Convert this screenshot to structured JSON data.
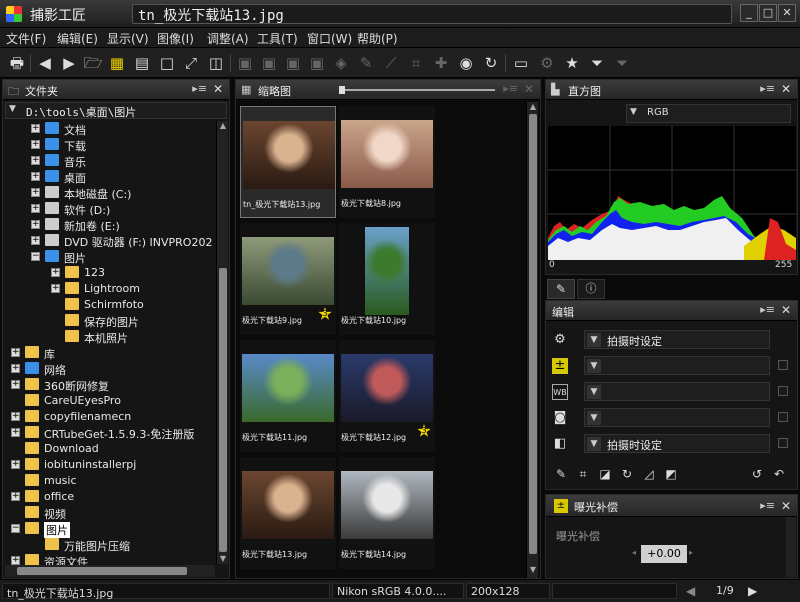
{
  "window": {
    "app_title": "捕影工匠",
    "file_title": "tn_极光下载站13.jpg",
    "minimize": "_",
    "maximize": "□",
    "close": "✕"
  },
  "menu": [
    "文件(F)",
    "编辑(E)",
    "显示(V)",
    "图像(I)",
    "调整(A)",
    "工具(T)",
    "窗口(W)",
    "帮助(P)"
  ],
  "toolbar": {
    "icons": [
      "print-icon",
      "back-icon",
      "forward-icon",
      "open-folder-icon",
      "grid-view-icon",
      "filmstrip-view-icon",
      "single-view-icon",
      "fullscreen-icon",
      "compare-icon",
      "layout-1-icon",
      "layout-2-icon",
      "layout-3-icon",
      "layout-4-icon",
      "layout-5-icon",
      "pen-icon",
      "straighten-icon",
      "crop-icon",
      "retouch-icon",
      "app-icon",
      "rotate-icon",
      "monitor-icon",
      "settings-icon",
      "star-icon",
      "filter-icon",
      "filter-disabled-icon"
    ]
  },
  "folder_panel": {
    "title": "文件夹",
    "path": "D:\\tools\\桌面\\图片",
    "tree": [
      {
        "label": "文档",
        "expand": "+",
        "icon": "doc-folder"
      },
      {
        "label": "下载",
        "expand": "+",
        "icon": "download-folder"
      },
      {
        "label": "音乐",
        "expand": "+",
        "icon": "music-folder"
      },
      {
        "label": "桌面",
        "expand": "+",
        "icon": "desktop-folder"
      },
      {
        "label": "本地磁盘 (C:)",
        "expand": "+",
        "icon": "drive"
      },
      {
        "label": "软件 (D:)",
        "expand": "+",
        "icon": "drive"
      },
      {
        "label": "新加卷 (E:)",
        "expand": "+",
        "icon": "drive"
      },
      {
        "label": "DVD 驱动器 (F:) INVPRO202",
        "expand": "+",
        "icon": "dvd"
      },
      {
        "label": "图片",
        "expand": "−",
        "icon": "pictures-folder"
      },
      {
        "label": "123",
        "expand": "+",
        "icon": "folder"
      },
      {
        "label": "Lightroom",
        "expand": "+",
        "icon": "folder"
      },
      {
        "label": "Schirmfoto",
        "expand": "",
        "icon": "folder"
      },
      {
        "label": "保存的图片",
        "expand": "",
        "icon": "folder"
      },
      {
        "label": "本机照片",
        "expand": "",
        "icon": "folder"
      },
      {
        "label": "库",
        "expand": "+",
        "icon": "library"
      },
      {
        "label": "网络",
        "expand": "+",
        "icon": "network"
      },
      {
        "label": "360断网修复",
        "expand": "+",
        "icon": "folder"
      },
      {
        "label": "CareUEyesPro",
        "expand": "",
        "icon": "folder"
      },
      {
        "label": "copyfilenamecn",
        "expand": "+",
        "icon": "folder"
      },
      {
        "label": "CRTubeGet-1.5.9.3-免注册版",
        "expand": "+",
        "icon": "folder"
      },
      {
        "label": "Download",
        "expand": "",
        "icon": "folder"
      },
      {
        "label": "iobituninstallerpj",
        "expand": "+",
        "icon": "folder"
      },
      {
        "label": "music",
        "expand": "",
        "icon": "folder"
      },
      {
        "label": "office",
        "expand": "+",
        "icon": "folder"
      },
      {
        "label": "视频",
        "expand": "",
        "icon": "folder"
      },
      {
        "label": "图片",
        "expand": "−",
        "icon": "folder"
      },
      {
        "label": "万能图片压缩",
        "expand": "",
        "icon": "folder"
      },
      {
        "label": "资源文件",
        "expand": "+",
        "icon": "folder"
      }
    ]
  },
  "thumb_panel": {
    "title": "缩略图",
    "items": [
      {
        "caption": "tn_极光下载站13.jpg",
        "star": "",
        "colors": [
          "#6b4630",
          "#d9b28f",
          "#2a1a12"
        ]
      },
      {
        "caption": "极光下载站8.jpg",
        "star": "",
        "colors": [
          "#c9a58a",
          "#f1d7c7",
          "#8b5a4a"
        ]
      },
      {
        "caption": "极光下载站9.jpg",
        "star": "3",
        "colors": [
          "#8e9a7a",
          "#5c7a8a",
          "#3a4a32"
        ]
      },
      {
        "caption": "极光下载站10.jpg",
        "star": "",
        "colors": [
          "#6aa0c8",
          "#3c7a2e",
          "#2a5a1e"
        ]
      },
      {
        "caption": "极光下载站11.jpg",
        "star": "",
        "colors": [
          "#5a8ac8",
          "#7ab05a",
          "#3a6a2a"
        ]
      },
      {
        "caption": "极光下载站12.jpg",
        "star": "3",
        "colors": [
          "#2a3a6a",
          "#c05a5a",
          "#1a1a2a"
        ]
      },
      {
        "caption": "极光下载站13.jpg",
        "star": "",
        "colors": [
          "#6b4630",
          "#d9b28f",
          "#2a1a12"
        ]
      },
      {
        "caption": "极光下载站14.jpg",
        "star": "",
        "colors": [
          "#b0b8c0",
          "#e8e8e8",
          "#3a3a3a"
        ]
      }
    ]
  },
  "histogram_panel": {
    "title": "直方图",
    "channel": "RGB",
    "min_label": "0",
    "max_label": "255"
  },
  "edit_panel": {
    "title": "编辑",
    "rows": [
      {
        "icon": "gear-icon",
        "value": "拍摄时设定"
      },
      {
        "icon": "exposure-icon",
        "value": ""
      },
      {
        "icon": "white-balance-icon",
        "value": ""
      },
      {
        "icon": "picture-control-icon",
        "value": ""
      },
      {
        "icon": "lens-icon",
        "value": "拍摄时设定"
      }
    ]
  },
  "exposure_panel": {
    "title": "曝光补偿",
    "label": "曝光补偿",
    "value": "+0.00"
  },
  "status": {
    "filename": "tn_极光下载站13.jpg",
    "profile": "Nikon sRGB 4.0.0....",
    "size": "200x128",
    "page": "1/9"
  }
}
